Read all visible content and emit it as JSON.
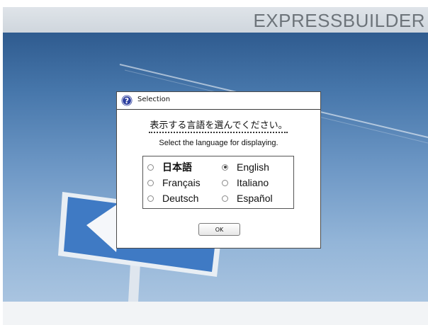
{
  "header": {
    "brand": "EXPRESSBUILDER"
  },
  "dialog": {
    "title": "Selection",
    "help_icon": "question-icon",
    "prompt_japanese": "表示する言語を選んでください。",
    "prompt_english": "Select the language for displaying.",
    "languages": [
      {
        "label": "日本語",
        "selected": false
      },
      {
        "label": "English",
        "selected": true
      },
      {
        "label": "Français",
        "selected": false
      },
      {
        "label": "Italiano",
        "selected": false
      },
      {
        "label": "Deutsch",
        "selected": false
      },
      {
        "label": "Español",
        "selected": false
      }
    ],
    "ok_label": "OK"
  },
  "colors": {
    "header_bg": "#d6dce2",
    "brand_text": "#6d747a",
    "help_icon": "#2c3e9e",
    "background_top": "#2f5b8f",
    "background_bottom": "#a9c4e0"
  }
}
